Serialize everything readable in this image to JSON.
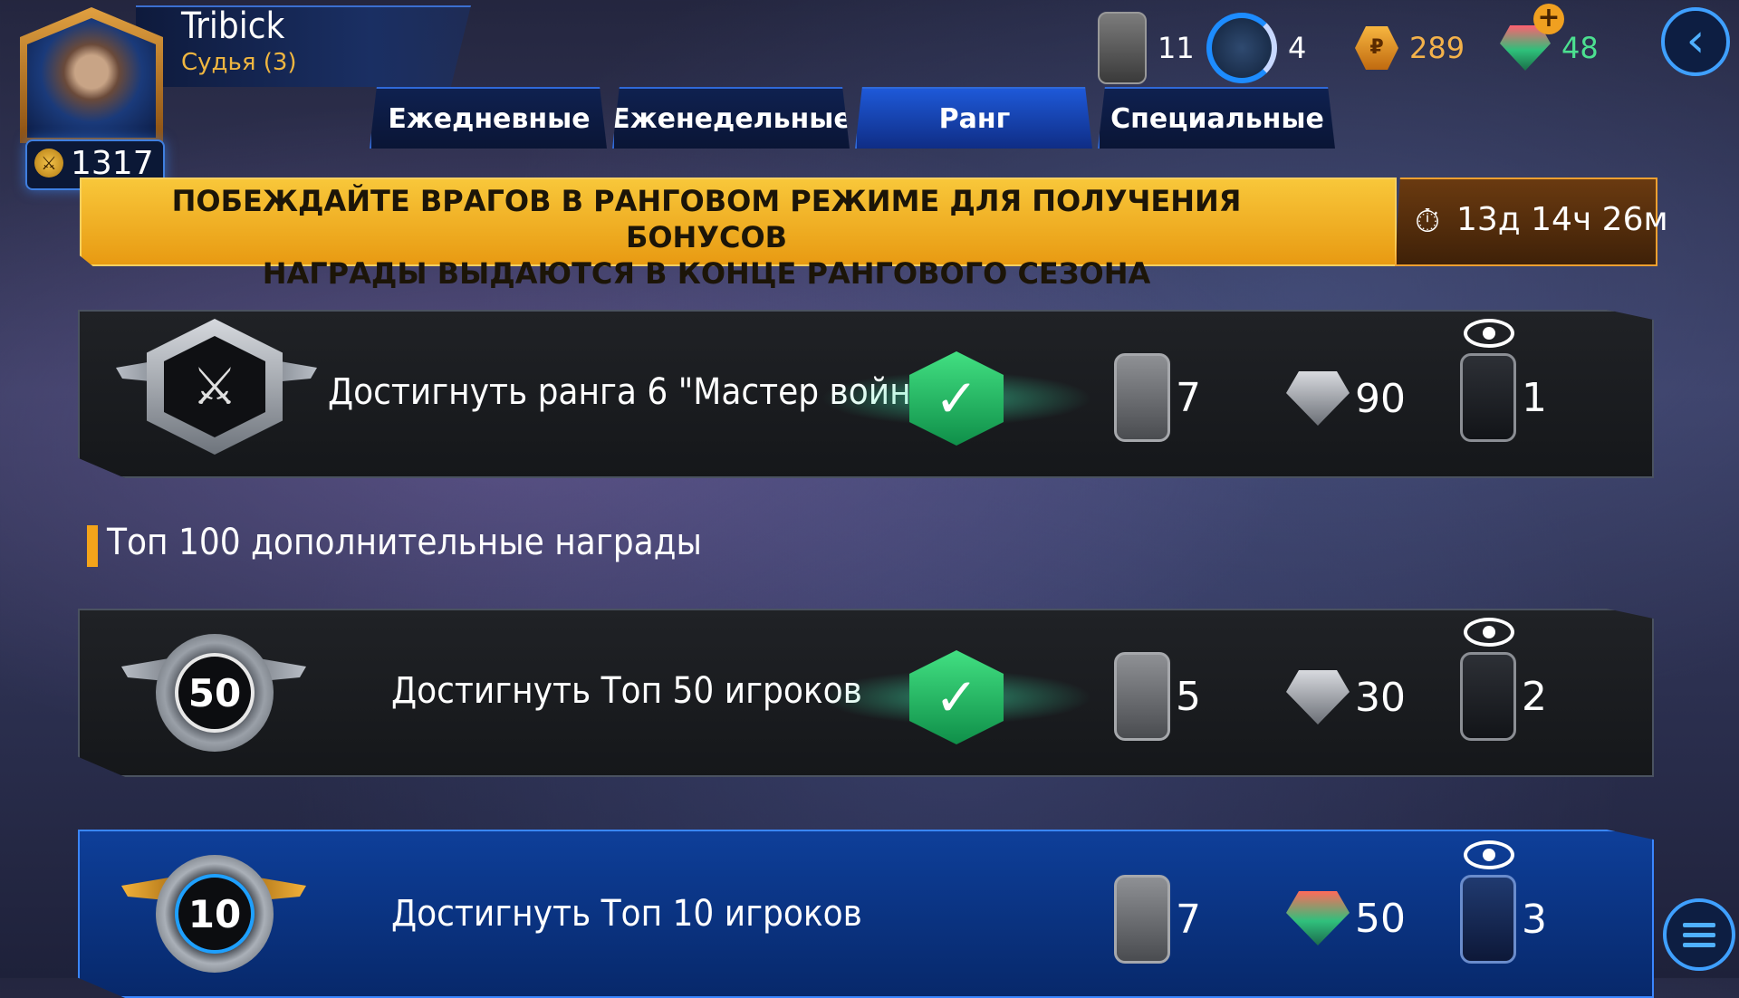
{
  "player": {
    "name": "Tribick",
    "title": "Судья (3)",
    "power": "1317"
  },
  "resources": {
    "cards": "11",
    "cycle": "4",
    "coins": "289",
    "gems": "48"
  },
  "tabs": [
    {
      "label": "Ежедневные",
      "active": false
    },
    {
      "label": "Еженедельные",
      "active": false
    },
    {
      "label": "Ранг",
      "active": true
    },
    {
      "label": "Специальные",
      "active": false
    }
  ],
  "banner": {
    "line1": "ПОБЕЖДАЙТЕ ВРАГОВ В РАНГОВОМ РЕЖИМЕ ДЛЯ ПОЛУЧЕНИЯ БОНУСОВ",
    "line2": "НАГРАДЫ ВЫДАЮТСЯ В КОНЦЕ РАНГОВОГО СЕЗОНА",
    "timer": "13д 14ч 26м"
  },
  "tasks": [
    {
      "text": "Достигнуть ранга 6 \"Мастер войны\"",
      "completed": true,
      "rewards": {
        "cards": "7",
        "crystals": "90",
        "packs": "1"
      }
    }
  ],
  "section_title": "Топ 100 дополнительные награды",
  "top_tasks": [
    {
      "badge": "50",
      "text": "Достигнуть Топ 50 игроков",
      "completed": true,
      "rewards": {
        "cards": "5",
        "crystals": "30",
        "packs": "2"
      }
    },
    {
      "badge": "10",
      "text": "Достигнуть Топ 10 игроков",
      "completed": false,
      "rewards": {
        "cards": "7",
        "crystals": "50",
        "packs": "3"
      }
    }
  ],
  "icons": {
    "power": "power-icon",
    "timer": "stopwatch-icon",
    "back": "chevron-left-icon",
    "menu": "menu-icon",
    "check": "checkmark-icon",
    "eye": "eye-icon"
  },
  "colors": {
    "accent": "#1d8cff",
    "banner": "#f2b22a",
    "complete": "#2fcf73",
    "section_marker": "#f4a41a"
  }
}
